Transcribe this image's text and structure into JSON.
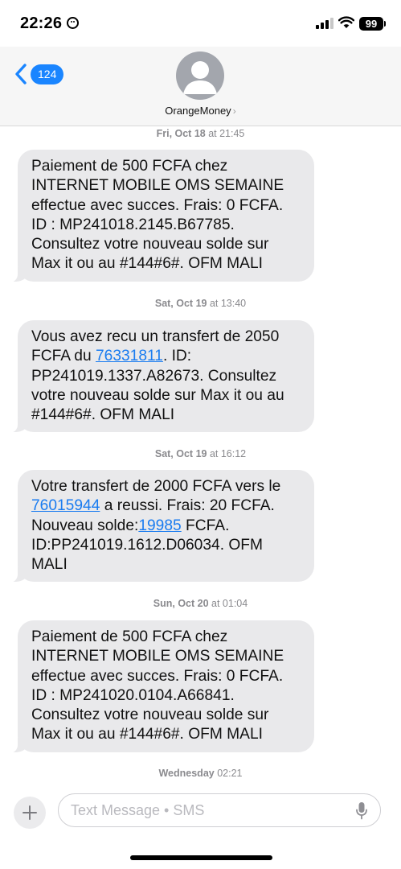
{
  "status_bar": {
    "time": "22:26",
    "battery": "99"
  },
  "header": {
    "back_count": "124",
    "contact_name": "OrangeMoney",
    "contact_chevron": "›"
  },
  "messages": [
    {
      "timestamp_day": "Fri, Oct 18",
      "timestamp_time": " at 21:45",
      "parts": [
        {
          "text": "Paiement de 500 FCFA chez INTERNET MOBILE OMS SEMAINE effectue avec succes. Frais: 0 FCFA. ID : MP241018.2145.B67785. Consultez votre nouveau solde sur Max it ou au #144#6#. OFM MALI"
        }
      ]
    },
    {
      "timestamp_day": "Sat, Oct 19",
      "timestamp_time": " at 13:40",
      "parts": [
        {
          "text": "Vous avez recu un transfert de 2050 FCFA du "
        },
        {
          "link": "76331811"
        },
        {
          "text": ". ID: PP241019.1337.A82673. Consultez votre nouveau solde sur Max it ou au #144#6#. OFM MALI"
        }
      ]
    },
    {
      "timestamp_day": "Sat, Oct 19",
      "timestamp_time": " at 16:12",
      "parts": [
        {
          "text": "Votre transfert de 2000 FCFA vers le "
        },
        {
          "link": "76015944"
        },
        {
          "text": " a reussi. Frais: 20 FCFA. Nouveau solde:"
        },
        {
          "link": "19985"
        },
        {
          "text": " FCFA. ID:PP241019.1612.D06034. OFM MALI"
        }
      ]
    },
    {
      "timestamp_day": "Sun, Oct 20",
      "timestamp_time": " at 01:04",
      "parts": [
        {
          "text": "Paiement de 500 FCFA chez INTERNET MOBILE OMS SEMAINE effectue avec succes. Frais: 0 FCFA. ID : MP241020.0104.A66841. Consultez votre nouveau solde sur Max it ou au #144#6#. OFM MALI"
        }
      ]
    }
  ],
  "last_timestamp": {
    "day": "Wednesday",
    "time": " 02:21"
  },
  "input": {
    "placeholder": "Text Message • SMS"
  },
  "colors": {
    "link": "#1a7cf0",
    "badge": "#1a85ff",
    "bubble": "#e9e9eb",
    "timestamp": "#8a8a8e"
  },
  "icons": {
    "back": "chevron-left-icon",
    "avatar": "person-icon",
    "plus": "plus-icon",
    "mic": "microphone-icon",
    "signal": "cellular-signal-icon",
    "wifi": "wifi-icon",
    "battery": "battery-icon"
  }
}
